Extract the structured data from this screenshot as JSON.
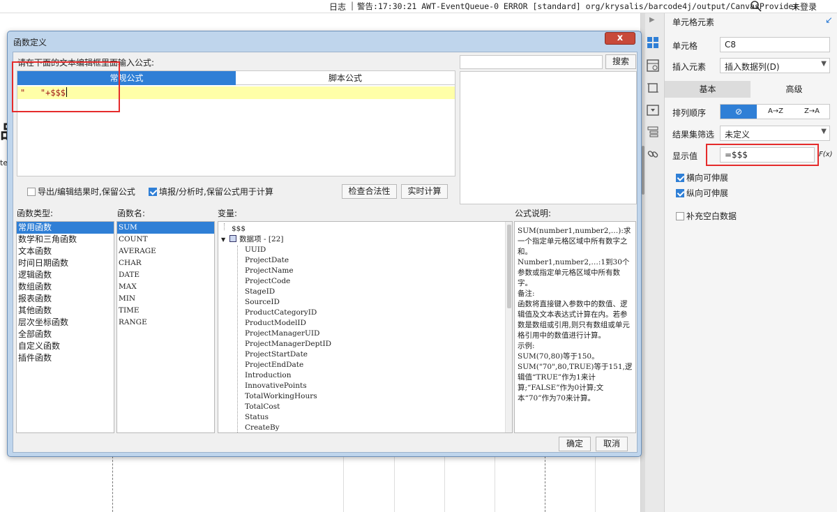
{
  "topbar": {
    "log_label": "日志",
    "separator": "|",
    "warning_text": "警告:17:30:21 AWT-EventQueue-0 ERROR [standard] org/krysalis/barcode4j/output/CanvasProvider",
    "search_icon": "search-icon",
    "login_label": "未登录"
  },
  "canvas": {
    "fragment_large": "品",
    "fragment_small": "te"
  },
  "toolbar": {
    "icons": [
      "cell-element-icon",
      "cell-attribute-icon",
      "widget-icon",
      "dropdown-icon",
      "list-icon",
      "link-icon"
    ],
    "accent": "#2f7fd6"
  },
  "panel": {
    "title": "单元格元素",
    "pin_icon": "pin-icon",
    "cell_label": "单元格",
    "cell_value": "C8",
    "insert_label": "插入元素",
    "insert_value": "插入数据列(D)",
    "tab_basic": "基本",
    "tab_advanced": "高级",
    "sort_label": "排列顺序",
    "sort_none": "⊘",
    "sort_asc": "A→Z",
    "sort_desc": "Z→A",
    "filter_label": "结果集筛选",
    "filter_value": "未定义",
    "display_label": "显示值",
    "display_value": "=$$$",
    "fx_label": "F(x)",
    "checks": [
      {
        "label": "横向可伸展",
        "checked": true
      },
      {
        "label": "纵向可伸展",
        "checked": true
      },
      {
        "label": "补充空白数据",
        "checked": false
      }
    ]
  },
  "dialog": {
    "title": "函数定义",
    "close_label": "x",
    "instruction": "请在下面的文本编辑框里面输入公式:",
    "tab_normal": "常规公式",
    "tab_script": "脚本公式",
    "formula_text": "\"   \"+$$$",
    "search_button": "搜索",
    "option1": "导出/编辑结果时,保留公式",
    "option1_checked": false,
    "option2": "填报/分析时,保留公式用于计算",
    "option2_checked": true,
    "check_button": "检查合法性",
    "realtime_button": "实时计算",
    "func_type_header": "函数类型:",
    "func_name_header": "函数名:",
    "variable_header": "变量:",
    "desc_header": "公式说明:",
    "func_types": [
      "常用函数",
      "数学和三角函数",
      "文本函数",
      "时间日期函数",
      "逻辑函数",
      "数组函数",
      "报表函数",
      "其他函数",
      "层次坐标函数",
      "全部函数",
      "自定义函数",
      "插件函数"
    ],
    "func_names": [
      "SUM",
      "COUNT",
      "AVERAGE",
      "CHAR",
      "DATE",
      "MAX",
      "MIN",
      "TIME",
      "RANGE"
    ],
    "variables": {
      "root": "$$$",
      "dataset": "数据项 - [22]",
      "fields": [
        "UUID",
        "ProjectDate",
        "ProjectName",
        "ProjectCode",
        "StageID",
        "SourceID",
        "ProductCategoryID",
        "ProductModelID",
        "ProjectManagerUID",
        "ProjectManagerDeptID",
        "ProjectStartDate",
        "ProjectEndDate",
        "Introduction",
        "InnovativePoints",
        "TotalWorkingHours",
        "TotalCost",
        "Status",
        "CreateBy"
      ]
    },
    "description": "SUM(number1,number2,…):求一个指定单元格区域中所有数字之和。\nNumber1,number2,…:1到30个参数或指定单元格区域中所有数字。\n备注:\n函数将直接键入参数中的数值、逻辑值及文本表达式计算在内。若参数是数组或引用,则只有数组或单元格引用中的数值进行计算。\n示例:\nSUM(70,80)等于150。\nSUM(\"70\",80,TRUE)等于151,逻辑值“TRUE”作为1来计算;“FALSE”作为0计算;文本“70”作为70来计算。",
    "ok_button": "确定",
    "cancel_button": "取消"
  }
}
